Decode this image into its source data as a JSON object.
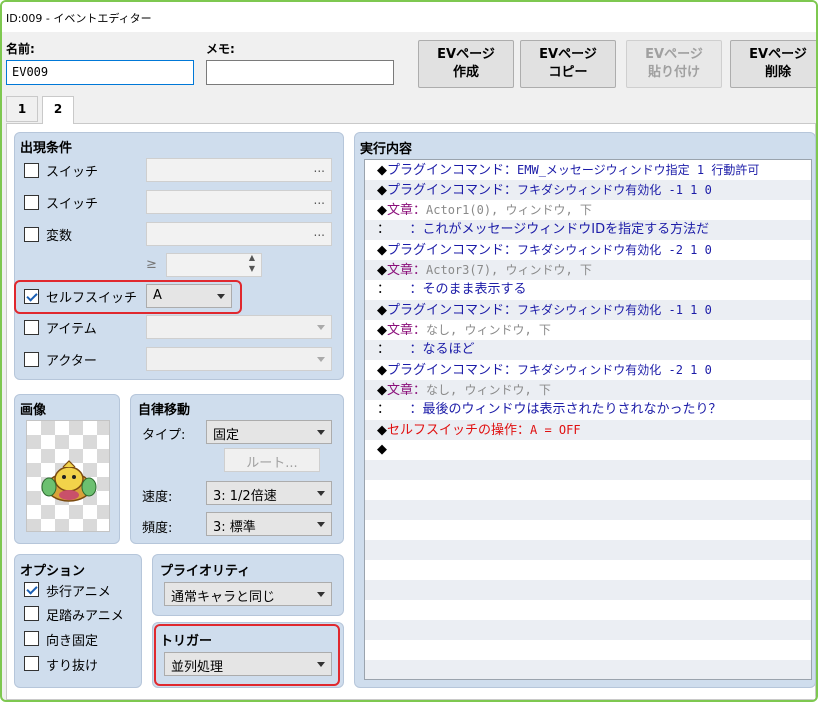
{
  "window": {
    "title": "ID:009 - イベントエディター"
  },
  "name_field": {
    "label": "名前:",
    "value": "EV009"
  },
  "memo_field": {
    "label": "メモ:",
    "value": ""
  },
  "buttons": {
    "create": [
      "EVページ",
      "作成"
    ],
    "copy": [
      "EVページ",
      "コピー"
    ],
    "paste": [
      "EVページ",
      "貼り付け"
    ],
    "delete": [
      "EVページ",
      "削除"
    ]
  },
  "tabs": [
    {
      "label": "1"
    },
    {
      "label": "2"
    }
  ],
  "conditions": {
    "title": "出現条件",
    "switch1": {
      "label": "スイッチ",
      "checked": false,
      "button": "..."
    },
    "switch2": {
      "label": "スイッチ",
      "checked": false,
      "button": "..."
    },
    "variable": {
      "label": "変数",
      "checked": false,
      "button": "..."
    },
    "gte": "≥",
    "self_switch": {
      "label": "セルフスイッチ",
      "checked": true,
      "value": "A"
    },
    "item": {
      "label": "アイテム",
      "checked": false
    },
    "actor": {
      "label": "アクター",
      "checked": false
    }
  },
  "image": {
    "title": "画像"
  },
  "autonomous": {
    "title": "自律移動",
    "type_label": "タイプ:",
    "type_value": "固定",
    "route_button": "ルート...",
    "speed_label": "速度:",
    "speed_value": "3: 1/2倍速",
    "freq_label": "頻度:",
    "freq_value": "3: 標準"
  },
  "options": {
    "title": "オプション",
    "walk": {
      "label": "歩行アニメ",
      "checked": true
    },
    "step": {
      "label": "足踏みアニメ",
      "checked": false
    },
    "dirfix": {
      "label": "向き固定",
      "checked": false
    },
    "through": {
      "label": "すり抜け",
      "checked": false
    }
  },
  "priority": {
    "title": "プライオリティ",
    "value": "通常キャラと同じ"
  },
  "trigger": {
    "title": "トリガー",
    "value": "並列処理"
  },
  "contents": {
    "title": "実行内容",
    "lines": [
      {
        "mark": "◆",
        "head": "プラグインコマンド：",
        "body": "EMW_メッセージウィンドウ指定 1 行動許可",
        "style": "plugin"
      },
      {
        "mark": "◆",
        "head": "プラグインコマンド：",
        "body": "フキダシウィンドウ有効化 -1 1 0",
        "style": "plugin"
      },
      {
        "mark": "◆",
        "head": "文章：",
        "body": "Actor1(0), ウィンドウ, 下",
        "style": "msg"
      },
      {
        "mark": "：",
        "head": "　　：",
        "body": "これがメッセージウィンドウIDを指定する方法だ",
        "style": "body"
      },
      {
        "mark": "◆",
        "head": "プラグインコマンド：",
        "body": "フキダシウィンドウ有効化 -2 1 0",
        "style": "plugin"
      },
      {
        "mark": "◆",
        "head": "文章：",
        "body": "Actor3(7), ウィンドウ, 下",
        "style": "msg"
      },
      {
        "mark": "：",
        "head": "　　：",
        "body": "そのまま表示する",
        "style": "body"
      },
      {
        "mark": "◆",
        "head": "プラグインコマンド：",
        "body": "フキダシウィンドウ有効化 -1 1 0",
        "style": "plugin"
      },
      {
        "mark": "◆",
        "head": "文章：",
        "body": "なし, ウィンドウ, 下",
        "style": "msg"
      },
      {
        "mark": "：",
        "head": "　　：",
        "body": "なるほど",
        "style": "body"
      },
      {
        "mark": "◆",
        "head": "プラグインコマンド：",
        "body": "フキダシウィンドウ有効化 -2 1 0",
        "style": "plugin"
      },
      {
        "mark": "◆",
        "head": "文章：",
        "body": "なし, ウィンドウ, 下",
        "style": "msg"
      },
      {
        "mark": "：",
        "head": "　　：",
        "body": "最後のウィンドウは表示されたりされなかったり？",
        "style": "body"
      },
      {
        "mark": "◆",
        "head": "セルフスイッチの操作：",
        "body": "A = OFF",
        "style": "red"
      },
      {
        "mark": "◆",
        "head": "",
        "body": "",
        "style": "plain"
      }
    ]
  }
}
